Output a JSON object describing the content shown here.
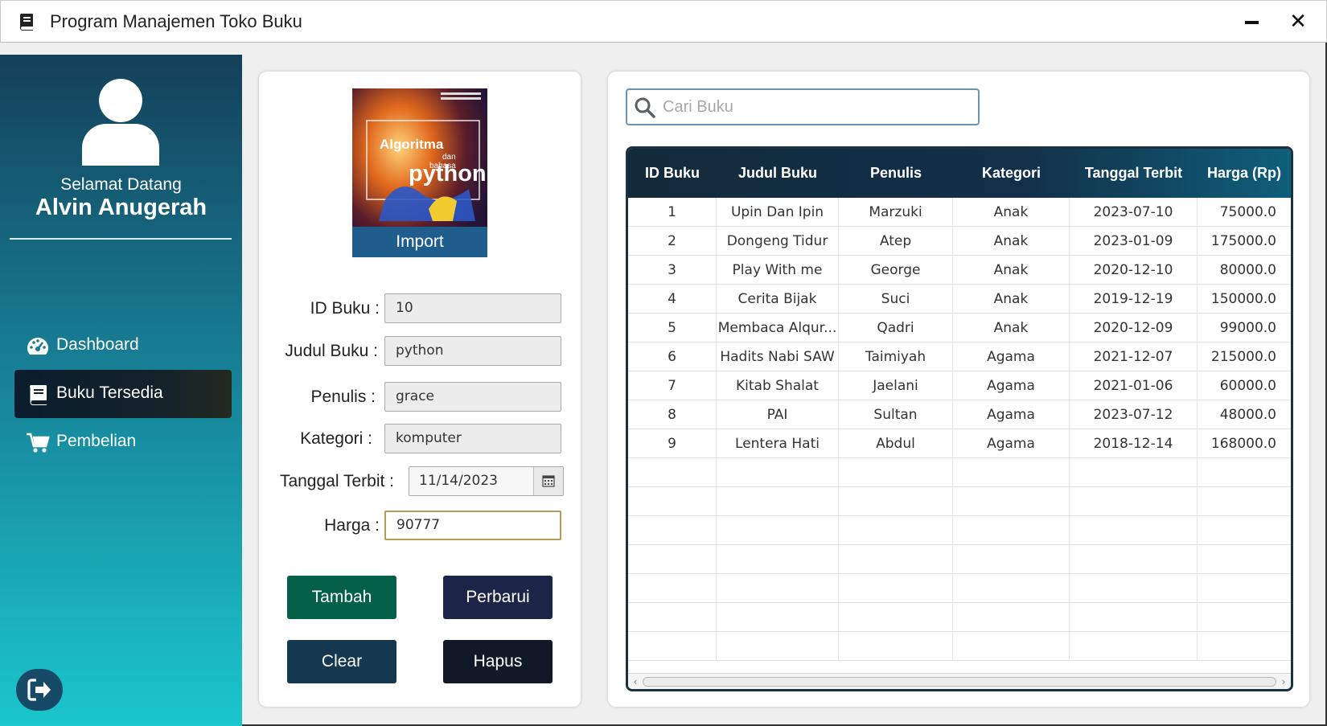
{
  "window": {
    "title": "Program Manajemen Toko Buku",
    "minimize_icon": "minimize-icon",
    "close_label": "✕"
  },
  "sidebar": {
    "welcome": "Selamat Datang",
    "username": "Alvin Anugerah",
    "items": [
      {
        "label": "Dashboard",
        "icon": "dashboard-icon",
        "active": false
      },
      {
        "label": "Buku Tersedia",
        "icon": "book-icon",
        "active": true
      },
      {
        "label": "Pembelian",
        "icon": "cart-icon",
        "active": false
      }
    ],
    "logout_icon": "logout-icon"
  },
  "form": {
    "cover_text_top": "Algoritma",
    "cover_text_mid": "dan",
    "cover_text_sub": "bahasa",
    "cover_text_main": "python",
    "import_label": "Import",
    "fields": {
      "id": {
        "label": "ID Buku :",
        "value": "10"
      },
      "judul": {
        "label": "Judul Buku :",
        "value": "python"
      },
      "penulis": {
        "label": "Penulis :",
        "value": "grace"
      },
      "kategori": {
        "label": "Kategori :",
        "value": "komputer"
      },
      "tanggal": {
        "label": "Tanggal Terbit :",
        "value": "11/14/2023"
      },
      "harga": {
        "label": "Harga :",
        "value": "90777"
      }
    },
    "buttons": {
      "tambah": "Tambah",
      "perbarui": "Perbarui",
      "clear": "Clear",
      "hapus": "Hapus"
    }
  },
  "search": {
    "placeholder": "Cari Buku"
  },
  "table": {
    "columns": [
      "ID Buku",
      "Judul Buku",
      "Penulis",
      "Kategori",
      "Tanggal Terbit",
      "Harga (Rp)"
    ],
    "rows": [
      [
        "1",
        "Upin Dan Ipin",
        "Marzuki",
        "Anak",
        "2023-07-10",
        "75000.0"
      ],
      [
        "2",
        "Dongeng Tidur",
        "Atep",
        "Anak",
        "2023-01-09",
        "175000.0"
      ],
      [
        "3",
        "Play With me",
        "George",
        "Anak",
        "2020-12-10",
        "80000.0"
      ],
      [
        "4",
        "Cerita Bijak",
        "Suci",
        "Anak",
        "2019-12-19",
        "150000.0"
      ],
      [
        "5",
        "Membaca Alqur...",
        "Qadri",
        "Anak",
        "2020-12-09",
        "99000.0"
      ],
      [
        "6",
        "Hadits Nabi SAW",
        "Taimiyah",
        "Agama",
        "2021-12-07",
        "215000.0"
      ],
      [
        "7",
        "Kitab Shalat",
        "Jaelani",
        "Agama",
        "2021-01-06",
        "60000.0"
      ],
      [
        "8",
        "PAI",
        "Sultan",
        "Agama",
        "2023-07-12",
        "48000.0"
      ],
      [
        "9",
        "Lentera Hati",
        "Abdul",
        "Agama",
        "2018-12-14",
        "168000.0"
      ]
    ],
    "empty_rows": 7
  },
  "colors": {
    "tambah": "#05604a",
    "perbarui": "#1c2447",
    "clear": "#153750",
    "hapus": "#111827",
    "header_bg": "#132a3a",
    "sidebar_top": "#14405a",
    "sidebar_bottom": "#1bc6cd"
  }
}
